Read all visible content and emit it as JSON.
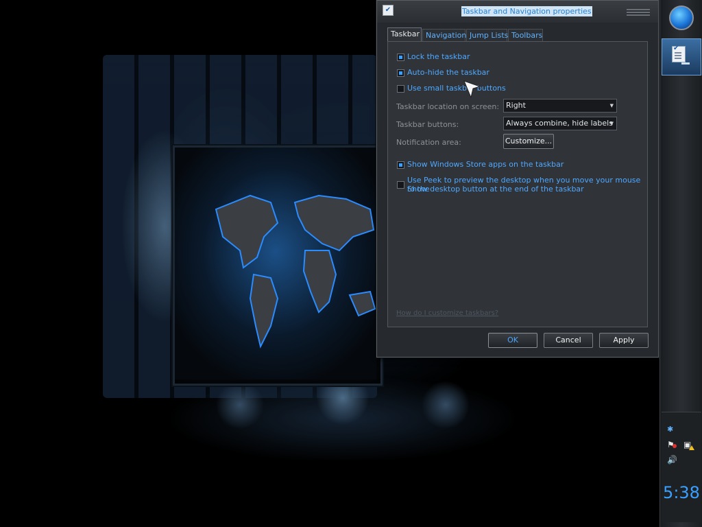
{
  "dialog": {
    "title": "Taskbar and Navigation properties",
    "tabs": [
      {
        "label": "Taskbar",
        "active": true
      },
      {
        "label": "Navigation",
        "active": false
      },
      {
        "label": "Jump Lists",
        "active": false
      },
      {
        "label": "Toolbars",
        "active": false
      }
    ],
    "checkboxes": {
      "lock_taskbar": {
        "label": "Lock the taskbar",
        "checked": true
      },
      "auto_hide": {
        "label": "Auto-hide the taskbar",
        "checked": true
      },
      "small_buttons": {
        "label": "Use small taskbar buttons",
        "checked": false
      },
      "store_apps": {
        "label": "Show Windows Store apps on the taskbar",
        "checked": true
      },
      "peek_line1": "Use Peek to preview the desktop when you move your mouse to the",
      "peek_line2": "Show desktop button at the end of the taskbar"
    },
    "fields": {
      "location_label": "Taskbar location on screen:",
      "location_value": "Right",
      "buttons_label": "Taskbar buttons:",
      "buttons_value": "Always combine, hide labels",
      "notification_label": "Notification area:",
      "customize_button": "Customize..."
    },
    "help_link": "How do I customize taskbars?",
    "buttons": {
      "ok": "OK",
      "cancel": "Cancel",
      "apply": "Apply"
    }
  },
  "taskbar": {
    "clock": "5:38"
  },
  "colors": {
    "accent": "#3aa0ff",
    "dialog_bg": "#26292d",
    "panel_bg": "#303439"
  }
}
